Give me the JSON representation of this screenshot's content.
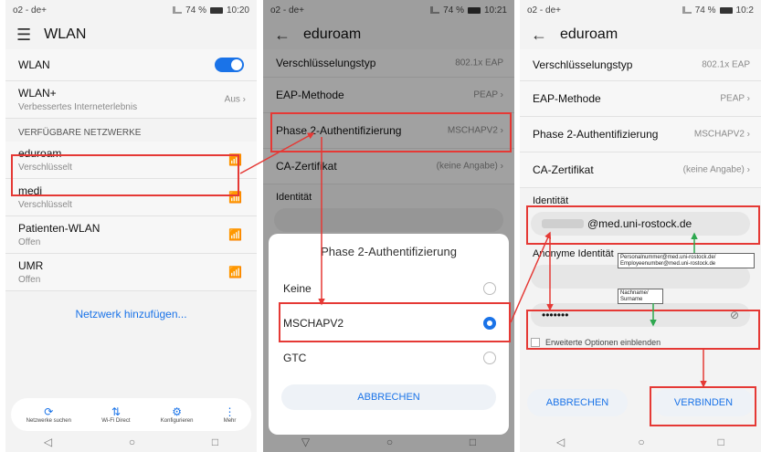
{
  "panel1": {
    "status": {
      "carrier": "o2 - de+",
      "battery": "74 %",
      "time": "10:20"
    },
    "title": "WLAN",
    "wlan_label": "WLAN",
    "wlan_plus": {
      "title": "WLAN+",
      "subtitle": "Verbessertes Interneterlebnis",
      "value": "Aus"
    },
    "section": "VERFÜGBARE NETZWERKE",
    "networks": [
      {
        "name": "eduroam",
        "status": "Verschlüsselt"
      },
      {
        "name": "medi",
        "status": "Verschlüsselt"
      },
      {
        "name": "Patienten-WLAN",
        "status": "Offen"
      },
      {
        "name": "UMR",
        "status": "Offen"
      }
    ],
    "add_network": "Netzwerk hinzufügen...",
    "tools": [
      {
        "label": "Netzwerke suchen"
      },
      {
        "label": "Wi-Fi Direct"
      },
      {
        "label": "Konfigurieren"
      },
      {
        "label": "Mehr"
      }
    ]
  },
  "panel2": {
    "status": {
      "carrier": "o2 - de+",
      "battery": "74 %",
      "time": "10:21"
    },
    "title": "eduroam",
    "rows": [
      {
        "label": "Verschlüsselungstyp",
        "value": "802.1x EAP"
      },
      {
        "label": "EAP-Methode",
        "value": "PEAP"
      },
      {
        "label": "Phase 2-Authentifizierung",
        "value": "MSCHAPV2"
      },
      {
        "label": "CA-Zertifikat",
        "value": "(keine Angabe)"
      }
    ],
    "identity_label": "Identität",
    "dialog": {
      "title": "Phase 2-Authentifizierung",
      "options": [
        "Keine",
        "MSCHAPV2",
        "GTC"
      ],
      "cancel": "ABBRECHEN"
    }
  },
  "panel3": {
    "status": {
      "carrier": "o2 - de+",
      "battery": "74 %",
      "time": "10:2"
    },
    "title": "eduroam",
    "rows": [
      {
        "label": "Verschlüsselungstyp",
        "value": "802.1x EAP"
      },
      {
        "label": "EAP-Methode",
        "value": "PEAP"
      },
      {
        "label": "Phase 2-Authentifizierung",
        "value": "MSCHAPV2"
      },
      {
        "label": "CA-Zertifikat",
        "value": "(keine Angabe)"
      }
    ],
    "identity_label": "Identität",
    "identity_value": "@med.uni-rostock.de",
    "anon_label": "Anonyme Identität",
    "note1": "Personalnummer@med.uni-rostock.de/ Employeenumber@med.uni-rostock.de",
    "note2": "Nachname/ Surname",
    "password_mask": "•••••••",
    "advanced": "Erweiterte Optionen einblenden",
    "cancel": "ABBRECHEN",
    "connect": "VERBINDEN"
  }
}
